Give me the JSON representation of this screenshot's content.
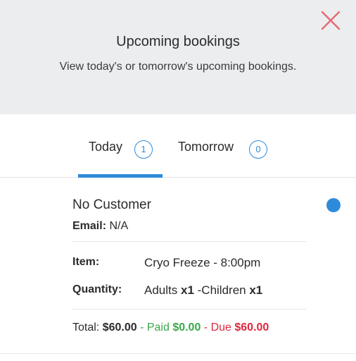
{
  "header": {
    "title": "Upcoming bookings",
    "subtitle": "View today's or tomorrow's upcoming bookings.",
    "close_icon": "close-x-icon",
    "close_color": "#e86a72"
  },
  "tabs": [
    {
      "label": "Today",
      "count": "1",
      "active": true
    },
    {
      "label": "Tomorrow",
      "count": "0",
      "active": false
    }
  ],
  "booking": {
    "customer": "No Customer",
    "email_label": "Email:",
    "email_value": "N/A",
    "item_label": "Item:",
    "item_value": "Cryo Freeze - 8:00pm",
    "quantity_label": "Quantity:",
    "quantity_adults_label": "Adults ",
    "quantity_adults_count": "x1",
    "quantity_sep": " -Children ",
    "quantity_children_count": "x1",
    "total_label": "Total: ",
    "total_value": "$60.00",
    "paid_label": " - Paid ",
    "paid_value": "$0.00",
    "due_label": " - Due ",
    "due_value": "$60.00"
  },
  "colors": {
    "accent": "#2e8bd9",
    "paid": "#3aa84a",
    "due": "#e0283c",
    "header_bg": "#ecedef"
  }
}
